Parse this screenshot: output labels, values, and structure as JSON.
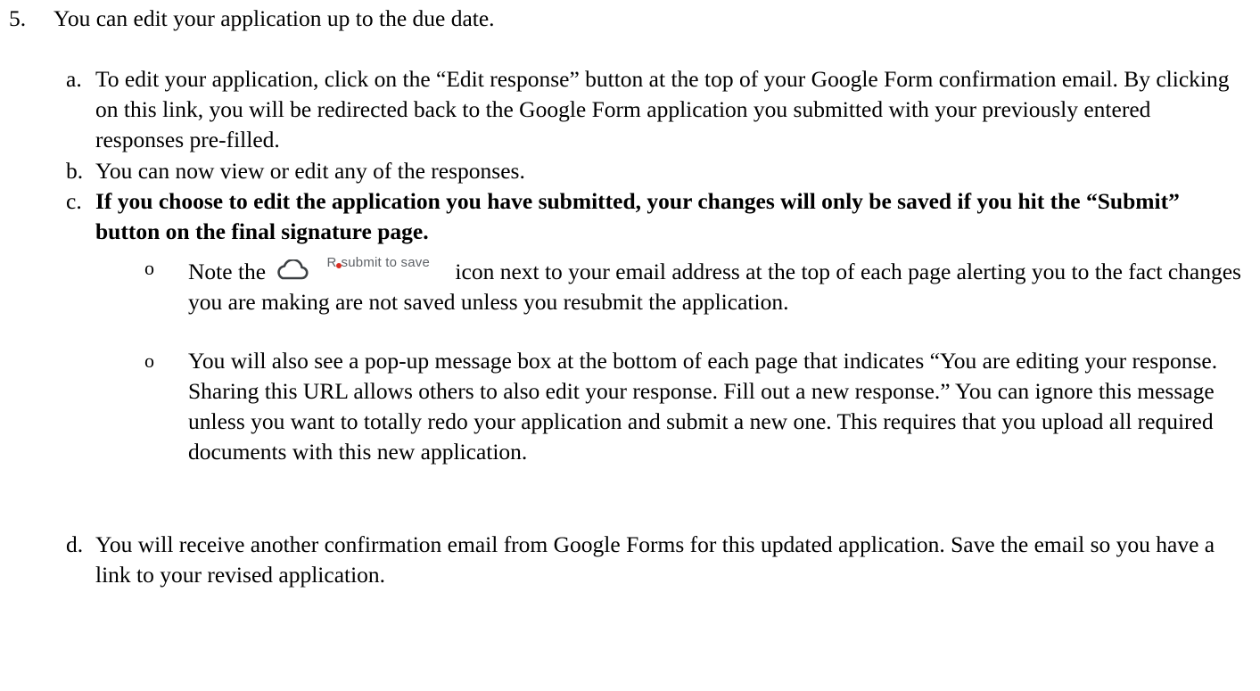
{
  "step": {
    "marker": "5.",
    "text": "You can edit your application up to the due date."
  },
  "items": [
    {
      "marker": "a.",
      "text": "To edit your application, click on the “Edit response” button at the top of your Google Form confirmation email. By clicking on this link, you will be redirected back to the Google Form application you submitted with your previously entered responses pre-filled."
    },
    {
      "marker": "b.",
      "text": "You can now view or edit any of the responses."
    },
    {
      "marker": "c.",
      "text": "If you choose to edit the application you have submitted, your changes will only be saved if you hit the “Submit” button on the final signature page."
    },
    {
      "marker": "d.",
      "text": "You will receive another confirmation email from Google Forms for this updated application. Save the email so you have a link to your revised application."
    }
  ],
  "bullets": [
    {
      "marker": "o",
      "before": "Note the",
      "chip": {
        "icon": "cloud-icon",
        "label_start": "R",
        "label_end": "submit to save",
        "dot_color": "#d93025"
      },
      "after": "icon next to your email address at the top of each page alerting you to the fact changes you are making are not saved unless you resubmit the application."
    },
    {
      "marker": "o",
      "text": "You will also see a pop-up message box at the bottom of each page that indicates “You are editing your response. Sharing this URL allows others to also edit your response. Fill out a new response.” You can ignore this message unless you want to totally redo your application and submit a new one. This requires that you upload all required documents with this new application."
    }
  ]
}
